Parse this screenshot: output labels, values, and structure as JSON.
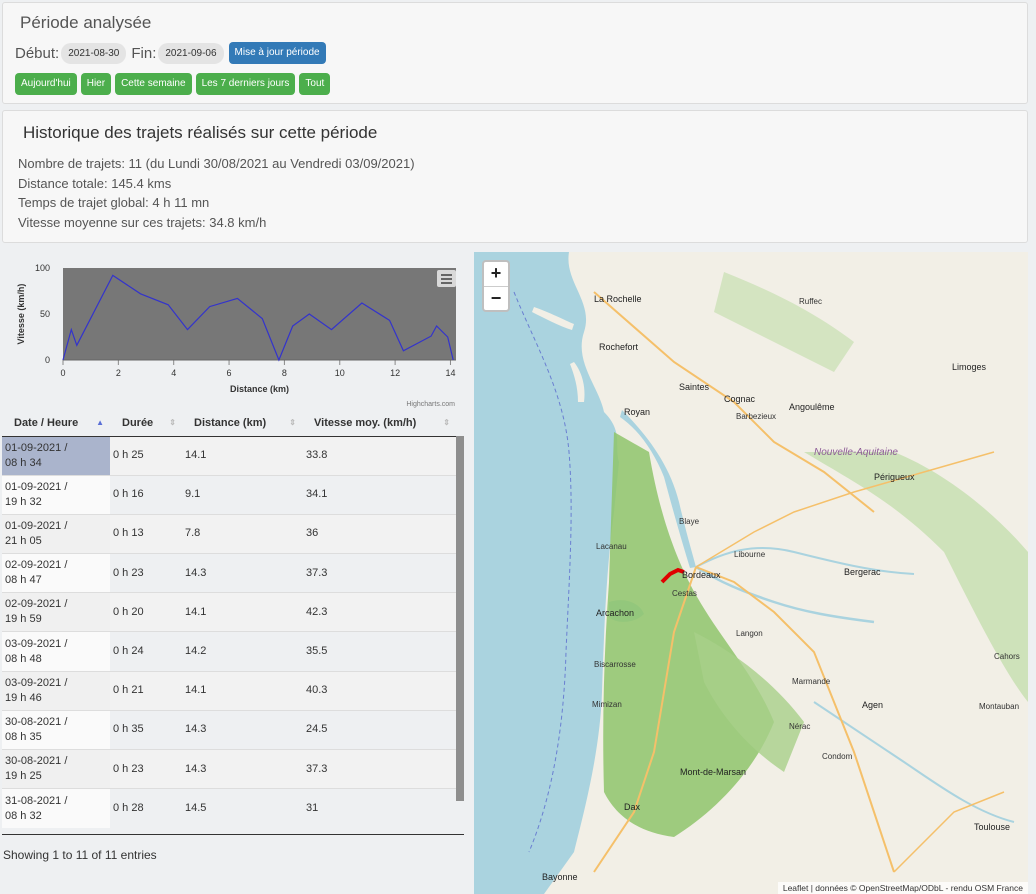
{
  "period": {
    "title": "Période analysée",
    "start_label": "Début:",
    "start_value": "2021-08-30",
    "end_label": "Fin:",
    "end_value": "2021-09-06",
    "update_button": "Mise à jour période",
    "quick_buttons": [
      "Aujourd'hui",
      "Hier",
      "Cette semaine",
      "Les 7 derniers jours",
      "Tout"
    ]
  },
  "history": {
    "title": "Historique des trajets réalisés sur cette période",
    "lines": [
      "Nombre de trajets: 11 (du Lundi 30/08/2021 au Vendredi 03/09/2021)",
      "Distance totale: 145.4 kms",
      "Temps de trajet global: 4 h 11 mn",
      "Vitesse moyenne sur ces trajets: 34.8 km/h"
    ]
  },
  "chart_data": {
    "type": "line",
    "xlabel": "Distance (km)",
    "ylabel": "Vitesse (km/h)",
    "xlim": [
      0,
      14.2
    ],
    "ylim": [
      0,
      100
    ],
    "xticks": [
      0,
      2,
      4,
      6,
      8,
      10,
      12,
      14
    ],
    "yticks": [
      0,
      50,
      100
    ],
    "credit": "Highcharts.com",
    "series": [
      {
        "color": "#3333cc",
        "x": [
          0,
          0.3,
          0.5,
          1.8,
          2.8,
          3.8,
          4.5,
          5.3,
          6.3,
          7.2,
          7.8,
          8.3,
          8.9,
          9.7,
          10.8,
          11.8,
          12.3,
          13.3,
          13.5,
          13.9,
          14.1
        ],
        "y": [
          0,
          33,
          16,
          92,
          72,
          60,
          33,
          58,
          67,
          45,
          0,
          37,
          50,
          33,
          62,
          43,
          10,
          26,
          37,
          25,
          0
        ]
      }
    ],
    "background": "#777777"
  },
  "table": {
    "headers": [
      "Date / Heure",
      "Durée",
      "Distance (km)",
      "Vitesse moy. (km/h)"
    ],
    "rows": [
      [
        "01-09-2021 /",
        "08 h 34",
        "0 h 25",
        "14.1",
        "33.8"
      ],
      [
        "01-09-2021 /",
        "19 h 32",
        "0 h 16",
        "9.1",
        "34.1"
      ],
      [
        "01-09-2021 /",
        "21 h 05",
        "0 h 13",
        "7.8",
        "36"
      ],
      [
        "02-09-2021 /",
        "08 h 47",
        "0 h 23",
        "14.3",
        "37.3"
      ],
      [
        "02-09-2021 /",
        "19 h 59",
        "0 h 20",
        "14.1",
        "42.3"
      ],
      [
        "03-09-2021 /",
        "08 h 48",
        "0 h 24",
        "14.2",
        "35.5"
      ],
      [
        "03-09-2021 /",
        "19 h 46",
        "0 h 21",
        "14.1",
        "40.3"
      ],
      [
        "30-08-2021 /",
        "08 h 35",
        "0 h 35",
        "14.3",
        "24.5"
      ],
      [
        "30-08-2021 /",
        "19 h 25",
        "0 h 23",
        "14.3",
        "37.3"
      ],
      [
        "31-08-2021 /",
        "08 h 32",
        "0 h 28",
        "14.5",
        "31"
      ]
    ],
    "info": "Showing 1 to 11 of 11 entries"
  },
  "map": {
    "zoom_in": "+",
    "zoom_out": "−",
    "attribution": "Leaflet | données © OpenStreetMap/ODbL - rendu OSM France",
    "region_label": "Nouvelle-Aquitaine",
    "places": [
      {
        "name": "La Rochelle",
        "big": true
      },
      {
        "name": "Rochefort",
        "big": true
      },
      {
        "name": "Royan",
        "big": true
      },
      {
        "name": "Saintes",
        "big": true
      },
      {
        "name": "Cognac",
        "big": true
      },
      {
        "name": "Angoulême",
        "big": true
      },
      {
        "name": "Limoges",
        "big": true
      },
      {
        "name": "Périgueux",
        "big": true
      },
      {
        "name": "Bergerac",
        "big": true
      },
      {
        "name": "Bordeaux",
        "big": true
      },
      {
        "name": "Arcachon",
        "big": true
      },
      {
        "name": "Mont-de-Marsan",
        "big": true
      },
      {
        "name": "Dax",
        "big": true
      },
      {
        "name": "Agen",
        "big": true
      },
      {
        "name": "Bayonne",
        "big": true
      },
      {
        "name": "Toulouse",
        "big": true
      },
      {
        "name": "Cahors",
        "big": false
      },
      {
        "name": "Libourne",
        "big": false
      },
      {
        "name": "Lacanau",
        "big": false
      },
      {
        "name": "Cestas",
        "big": false
      },
      {
        "name": "Marmande",
        "big": false
      },
      {
        "name": "Mimizan",
        "big": false
      },
      {
        "name": "Biscarrosse",
        "big": false
      },
      {
        "name": "Langon",
        "big": false
      },
      {
        "name": "Blaye",
        "big": false
      },
      {
        "name": "Barbezieux",
        "big": false
      },
      {
        "name": "Montauban",
        "big": false
      },
      {
        "name": "Condom",
        "big": false
      },
      {
        "name": "Nérac",
        "big": false
      },
      {
        "name": "Ruffec",
        "big": false
      }
    ]
  }
}
